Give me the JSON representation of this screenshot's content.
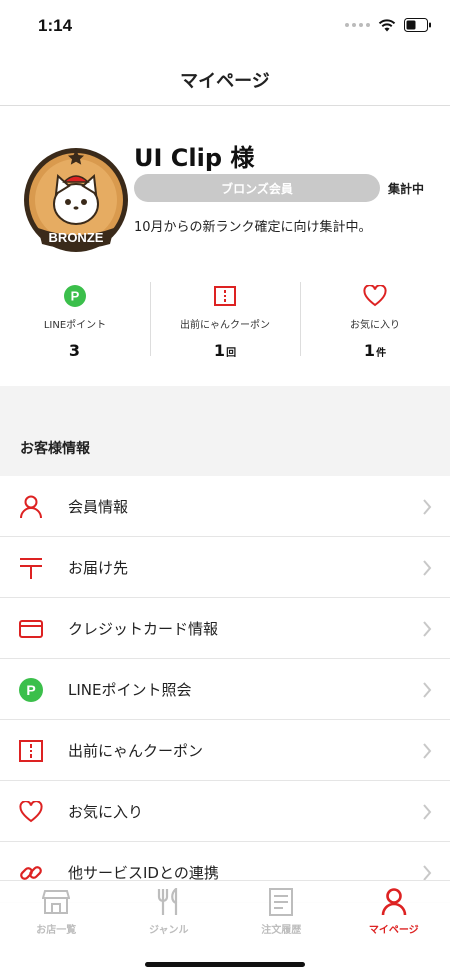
{
  "status": {
    "time": "1:14"
  },
  "header": {
    "title": "マイページ"
  },
  "profile": {
    "badge_text": "BRONZE",
    "name": "UI Clip 様",
    "rank_label": "ブロンズ会員",
    "rank_status": "集計中",
    "rank_note": "10月からの新ランク確定に向け集計中。"
  },
  "stats": [
    {
      "icon": "line-point-icon",
      "label": "LINEポイント",
      "value": "3",
      "unit": ""
    },
    {
      "icon": "coupon-icon",
      "label": "出前にゃんクーポン",
      "value": "1",
      "unit": "回"
    },
    {
      "icon": "heart-icon",
      "label": "お気に入り",
      "value": "1",
      "unit": "件"
    }
  ],
  "section": {
    "title": "お客様情報"
  },
  "menu": [
    {
      "icon": "user-icon",
      "label": "会員情報"
    },
    {
      "icon": "postal-mark-icon",
      "label": "お届け先"
    },
    {
      "icon": "credit-card-icon",
      "label": "クレジットカード情報"
    },
    {
      "icon": "line-point-icon",
      "label": "LINEポイント照会"
    },
    {
      "icon": "coupon-icon",
      "label": "出前にゃんクーポン"
    },
    {
      "icon": "heart-icon",
      "label": "お気に入り"
    },
    {
      "icon": "link-icon",
      "label": "他サービスIDとの連携"
    }
  ],
  "tabs": [
    {
      "icon": "store-icon",
      "label": "お店一覧",
      "active": false
    },
    {
      "icon": "fork-knife-icon",
      "label": "ジャンル",
      "active": false
    },
    {
      "icon": "receipt-icon",
      "label": "注文履歴",
      "active": false
    },
    {
      "icon": "user-icon",
      "label": "マイページ",
      "active": true
    }
  ],
  "colors": {
    "accent": "#d22222",
    "line_green": "#3bbf4b",
    "rank_gray": "#c9c9c9",
    "bronze": "#d99a4e"
  }
}
